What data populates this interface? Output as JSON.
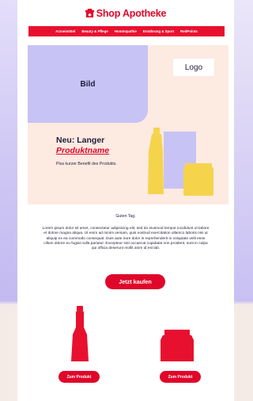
{
  "brand": {
    "name": "Shop Apotheke",
    "accent_color": "#e0062a",
    "logo_icon": "shop-apotheke-logo-icon"
  },
  "nav": {
    "items": [
      "Arzneimittel",
      "Beauty & Pflege",
      "Homöopathie",
      "Ernährung & Sport",
      "RedPoints"
    ]
  },
  "hero": {
    "image_placeholder": "Bild",
    "logo_placeholder": "Logo",
    "headline_line1": "Neu: Langer",
    "headline_line2": "Produktname",
    "benefit": "Plus kurzer Benefit des Produkts."
  },
  "content": {
    "greeting": "Guten Tag,",
    "body": "Lorem ipsum dolor sit amet, consectetur adipisicing elit, sed do eiusmod tempor incididunt ut labore et dolore magna aliqua. Ut enim ad minim veniam, quis nostrud exercitation ullamco laboris nisi ut aliquip ex ea commodo consequat. Duis aute irure dolor in reprehenderit in voluptate velit esse cillum dolore eu fugiat nulla pariatur. Excepteur sint occaecat cupidatat non proident, sunt in culpa qui officia deserunt mollit anim id est lab.",
    "cta_label": "Jetzt kaufen"
  },
  "products": [
    {
      "button_label": "Zum Produkt",
      "icon": "bottle-icon"
    },
    {
      "button_label": "Zum Produkt",
      "icon": "jar-icon"
    }
  ]
}
